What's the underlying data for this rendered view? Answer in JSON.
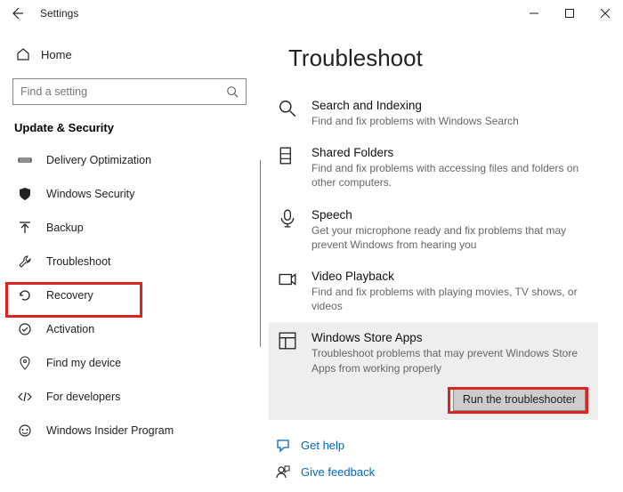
{
  "window": {
    "title": "Settings"
  },
  "sidebar": {
    "home_label": "Home",
    "search_placeholder": "Find a setting",
    "section_title": "Update & Security",
    "items": [
      {
        "label": "Delivery Optimization",
        "icon": "delivery"
      },
      {
        "label": "Windows Security",
        "icon": "shield"
      },
      {
        "label": "Backup",
        "icon": "backup"
      },
      {
        "label": "Troubleshoot",
        "icon": "wrench",
        "selected": true
      },
      {
        "label": "Recovery",
        "icon": "recovery"
      },
      {
        "label": "Activation",
        "icon": "activation"
      },
      {
        "label": "Find my device",
        "icon": "location"
      },
      {
        "label": "For developers",
        "icon": "dev"
      },
      {
        "label": "Windows Insider Program",
        "icon": "insider"
      }
    ]
  },
  "main": {
    "title": "Troubleshoot",
    "items": [
      {
        "title": "Search and Indexing",
        "desc": "Find and fix problems with Windows Search"
      },
      {
        "title": "Shared Folders",
        "desc": "Find and fix problems with accessing files and folders on other computers."
      },
      {
        "title": "Speech",
        "desc": "Get your microphone ready and fix problems that may prevent Windows from hearing you"
      },
      {
        "title": "Video Playback",
        "desc": "Find and fix problems with playing movies, TV shows, or videos"
      },
      {
        "title": "Windows Store Apps",
        "desc": "Troubleshoot problems that may prevent Windows Store Apps from working properly",
        "selected": true
      }
    ],
    "run_button": "Run the troubleshooter",
    "help": {
      "get_help": "Get help",
      "give_feedback": "Give feedback"
    }
  }
}
